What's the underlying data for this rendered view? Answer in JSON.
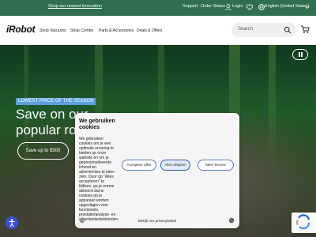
{
  "topbar": {
    "promo": "Shop our newest innovation",
    "support": "Support",
    "order_status": "Order Status",
    "login": "Login",
    "language": "English (United States)"
  },
  "header": {
    "logo": "iRobot",
    "nav": [
      "Shop Vacuums",
      "Shop Combo",
      "Parts & Accessories",
      "Deals & Offers"
    ],
    "search_placeholder": "Search"
  },
  "hero": {
    "badge": "LOWEST PRICE OF THE SEASON",
    "title": "Save on our\npopular robo",
    "cta": "Save up to $500"
  },
  "cookie": {
    "title": "We gebruiken cookies",
    "body": "We gebruiken cookies om je een optimale ervaring te bieden op onze website en om je gepersonaliseerde inhoud en advertenties te laten zien. Door op \"Alles accepteren\" te klikken, ga je ermee akkoord dat er cookies op je apparaat worden opgeslagen voor functionele, prestatie/analyse- en advertentiedoeleinden.",
    "buttons": [
      "Accepteer alles",
      "Alles afwijzen",
      "Meer keuzes"
    ],
    "policy_link": "Bekijk ons privacybeleid"
  },
  "colors": {
    "topbar": "#2f6f4f",
    "accent": "#5b9fe0",
    "accessibility": "#3b4fd8"
  },
  "icons": [
    "user-icon",
    "globe-icon",
    "search-icon",
    "cart-icon",
    "pause-icon",
    "accessibility-icon",
    "cookie-icon",
    "recaptcha-icon"
  ]
}
